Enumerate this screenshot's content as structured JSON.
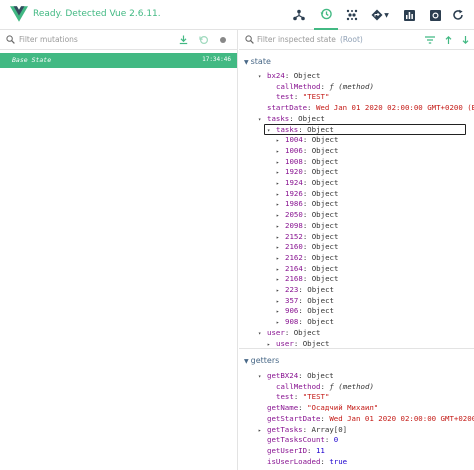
{
  "header": {
    "status": "Ready. Detected Vue 2.6.11.",
    "accent": "#42b983"
  },
  "left": {
    "filter_placeholder": "Filter mutations",
    "mutation": {
      "name": "Base State",
      "time": "17:34:46"
    }
  },
  "right": {
    "filter_placeholder": "Filter inspected state",
    "root_label": "(Root)",
    "state_label": "state",
    "getters_label": "getters",
    "state_rows": [
      {
        "indent": 1,
        "toggle": "▾",
        "key": "bx24",
        "sep": ": ",
        "val": "Object",
        "vt": "v"
      },
      {
        "indent": 2,
        "toggle": "",
        "key": "callMethod",
        "sep": ": ",
        "val": "ƒ (method)",
        "vt": "fn"
      },
      {
        "indent": 2,
        "toggle": "",
        "key": "test",
        "sep": ": ",
        "val": "\"TEST\"",
        "vt": "s"
      },
      {
        "indent": 1,
        "toggle": "",
        "key": "startDate",
        "sep": ": ",
        "val": "Wed Jan 01 2020 02:00:00 GMT+0200 (Восточная Европа)",
        "vt": "s"
      },
      {
        "indent": 1,
        "toggle": "▾",
        "key": "tasks",
        "sep": ": ",
        "val": "Object",
        "vt": "v"
      },
      {
        "indent": 2,
        "toggle": "▾",
        "key": "tasks",
        "sep": ": ",
        "val": "Object",
        "vt": "v",
        "highlight": true
      },
      {
        "indent": 3,
        "toggle": "▸",
        "key": "1004",
        "sep": ": ",
        "val": "Object",
        "vt": "v"
      },
      {
        "indent": 3,
        "toggle": "▸",
        "key": "1006",
        "sep": ": ",
        "val": "Object",
        "vt": "v"
      },
      {
        "indent": 3,
        "toggle": "▸",
        "key": "1008",
        "sep": ": ",
        "val": "Object",
        "vt": "v"
      },
      {
        "indent": 3,
        "toggle": "▸",
        "key": "1920",
        "sep": ": ",
        "val": "Object",
        "vt": "v"
      },
      {
        "indent": 3,
        "toggle": "▸",
        "key": "1924",
        "sep": ": ",
        "val": "Object",
        "vt": "v"
      },
      {
        "indent": 3,
        "toggle": "▸",
        "key": "1926",
        "sep": ": ",
        "val": "Object",
        "vt": "v"
      },
      {
        "indent": 3,
        "toggle": "▸",
        "key": "1986",
        "sep": ": ",
        "val": "Object",
        "vt": "v"
      },
      {
        "indent": 3,
        "toggle": "▸",
        "key": "2050",
        "sep": ": ",
        "val": "Object",
        "vt": "v"
      },
      {
        "indent": 3,
        "toggle": "▸",
        "key": "2098",
        "sep": ": ",
        "val": "Object",
        "vt": "v"
      },
      {
        "indent": 3,
        "toggle": "▸",
        "key": "2152",
        "sep": ": ",
        "val": "Object",
        "vt": "v"
      },
      {
        "indent": 3,
        "toggle": "▸",
        "key": "2160",
        "sep": ": ",
        "val": "Object",
        "vt": "v"
      },
      {
        "indent": 3,
        "toggle": "▸",
        "key": "2162",
        "sep": ": ",
        "val": "Object",
        "vt": "v"
      },
      {
        "indent": 3,
        "toggle": "▸",
        "key": "2164",
        "sep": ": ",
        "val": "Object",
        "vt": "v"
      },
      {
        "indent": 3,
        "toggle": "▸",
        "key": "2168",
        "sep": ": ",
        "val": "Object",
        "vt": "v"
      },
      {
        "indent": 3,
        "toggle": "▸",
        "key": "223",
        "sep": ": ",
        "val": "Object",
        "vt": "v"
      },
      {
        "indent": 3,
        "toggle": "▸",
        "key": "357",
        "sep": ": ",
        "val": "Object",
        "vt": "v"
      },
      {
        "indent": 3,
        "toggle": "▸",
        "key": "906",
        "sep": ": ",
        "val": "Object",
        "vt": "v"
      },
      {
        "indent": 3,
        "toggle": "▸",
        "key": "908",
        "sep": ": ",
        "val": "Object",
        "vt": "v"
      },
      {
        "indent": 1,
        "toggle": "▾",
        "key": "user",
        "sep": ": ",
        "val": "Object",
        "vt": "v"
      },
      {
        "indent": 2,
        "toggle": "▸",
        "key": "user",
        "sep": ": ",
        "val": "Object",
        "vt": "v"
      }
    ],
    "getter_rows": [
      {
        "indent": 1,
        "toggle": "▾",
        "key": "getBX24",
        "sep": ": ",
        "val": "Object",
        "vt": "v"
      },
      {
        "indent": 2,
        "toggle": "",
        "key": "callMethod",
        "sep": ": ",
        "val": "ƒ (method)",
        "vt": "fn"
      },
      {
        "indent": 2,
        "toggle": "",
        "key": "test",
        "sep": ": ",
        "val": "\"TEST\"",
        "vt": "s"
      },
      {
        "indent": 1,
        "toggle": "",
        "key": "getName",
        "sep": ": ",
        "val": "\"Осадчий Михаил\"",
        "vt": "s"
      },
      {
        "indent": 1,
        "toggle": "",
        "key": "getStartDate",
        "sep": ": ",
        "val": "Wed Jan 01 2020 02:00:00 GMT+0200 (Восточная Европа)",
        "vt": "s"
      },
      {
        "indent": 1,
        "toggle": "▸",
        "key": "getTasks",
        "sep": ": ",
        "val": "Array[0]",
        "vt": "v"
      },
      {
        "indent": 1,
        "toggle": "",
        "key": "getTasksCount",
        "sep": ": ",
        "val": "0",
        "vt": "n"
      },
      {
        "indent": 1,
        "toggle": "",
        "key": "getUserID",
        "sep": ": ",
        "val": "11",
        "vt": "n"
      },
      {
        "indent": 1,
        "toggle": "",
        "key": "isUserLoaded",
        "sep": ": ",
        "val": "true",
        "vt": "b"
      }
    ]
  }
}
